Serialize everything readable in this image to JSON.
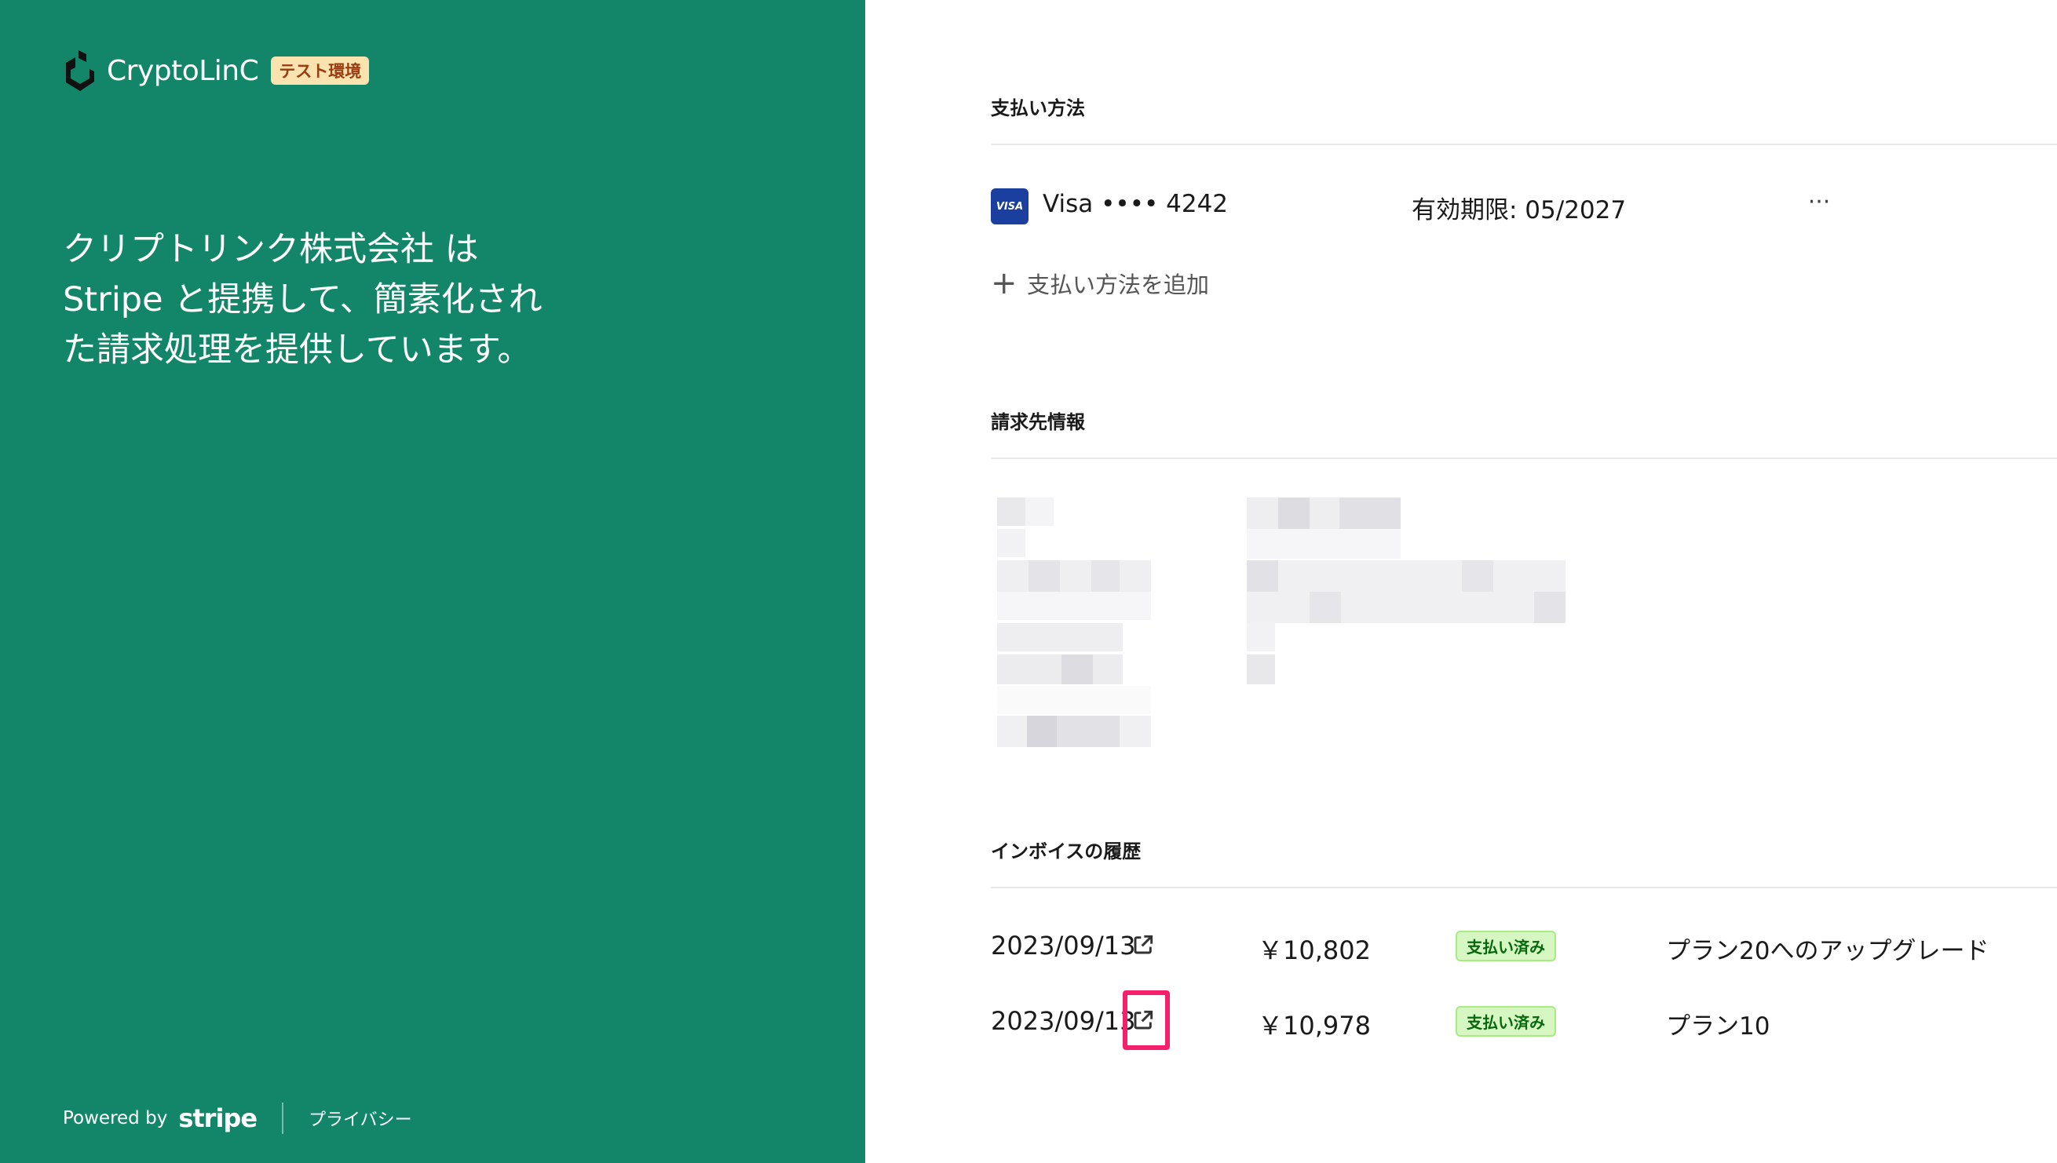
{
  "brand": {
    "name": "CryptoLinC",
    "env_badge": "テスト環境"
  },
  "left_panel": {
    "tagline": "クリプトリンク株式会社 は Stripe と提携して、簡素化された請求処理を提供しています。",
    "footer": {
      "powered_by": "Powered by",
      "stripe": "stripe",
      "privacy": "プライバシー"
    }
  },
  "payment_methods": {
    "title": "支払い方法",
    "card": {
      "brand_badge": "VISA",
      "label": "Visa •••• 4242",
      "expiry": "有効期限: 05/2027",
      "more": "···"
    },
    "add_label": "支払い方法を追加"
  },
  "billing_info": {
    "title": "請求先情報"
  },
  "invoice_history": {
    "title": "インボイスの履歴",
    "rows": [
      {
        "date": "2023/09/13",
        "amount": "￥10,802",
        "status": "支払い済み",
        "description": "プラン20へのアップグレード"
      },
      {
        "date": "2023/09/13",
        "amount": "￥10,978",
        "status": "支払い済み",
        "description": "プラン10"
      }
    ]
  },
  "colors": {
    "left_panel_bg": "#13866a",
    "badge_bg": "#fbe3b0",
    "paid_bg": "#d7f7c2",
    "paid_text": "#05690d",
    "highlight": "#f5206b"
  },
  "icons": [
    "cryptolinc-logo-icon",
    "visa-card-icon",
    "more-icon",
    "plus-icon",
    "external-link-icon"
  ]
}
